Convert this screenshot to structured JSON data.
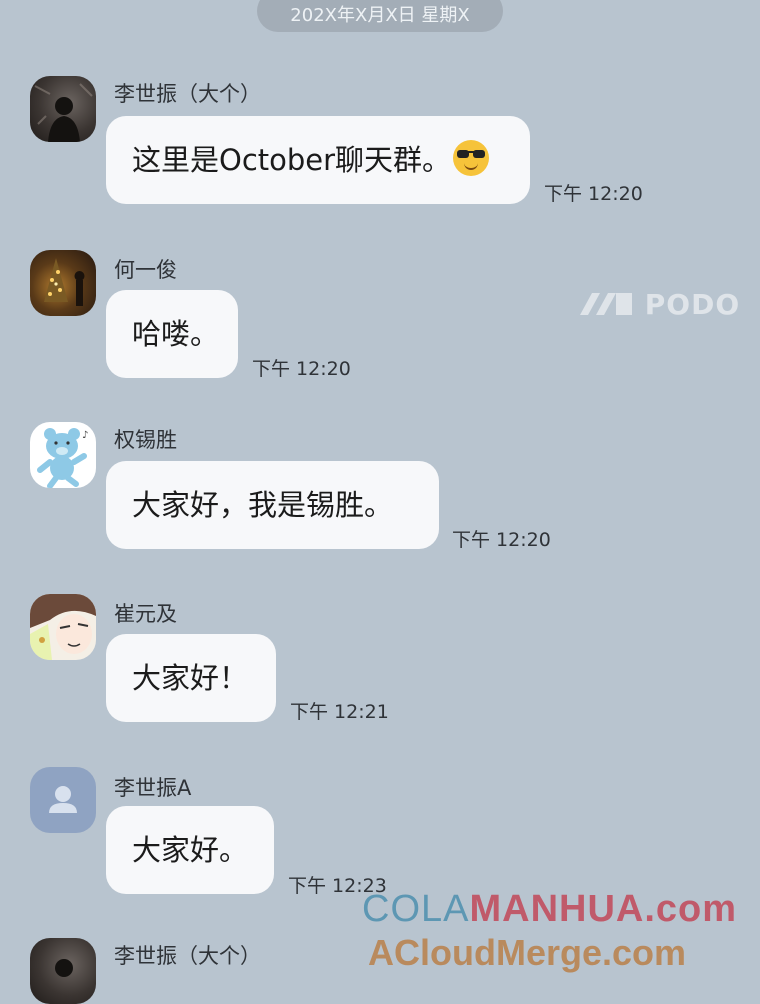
{
  "date_divider": "202X年X月X日 星期X",
  "messages": [
    {
      "sender": "李世振（大个）",
      "avatar": "night-portrait-photo",
      "text": "这里是October聊天群。",
      "emoji": "smiling-face-with-sunglasses",
      "time": "下午 12:20"
    },
    {
      "sender": "何一俊",
      "avatar": "christmas-tree-photo",
      "text": "哈喽。",
      "time": "下午 12:20"
    },
    {
      "sender": "权锡胜",
      "avatar": "blue-dancing-bear",
      "text": "大家好，我是锡胜。",
      "time": "下午 12:20"
    },
    {
      "sender": "崔元及",
      "avatar": "manga-face",
      "text": "大家好！",
      "time": "下午 12:21"
    },
    {
      "sender": "李世振A",
      "avatar": "default-person-icon",
      "text": "大家好。",
      "time": "下午 12:23"
    },
    {
      "sender": "李世振（大个）",
      "avatar": "night-portrait-photo"
    }
  ],
  "watermarks": {
    "podo": "PODO",
    "cola_prefix": "COLA",
    "cola_suffix": "MANHUA.com",
    "acloud": "ACloudMerge.com"
  },
  "colors": {
    "background": "#b8c4cf",
    "bubble": "#f7f8fa",
    "default_avatar": "#8fa3c2"
  }
}
